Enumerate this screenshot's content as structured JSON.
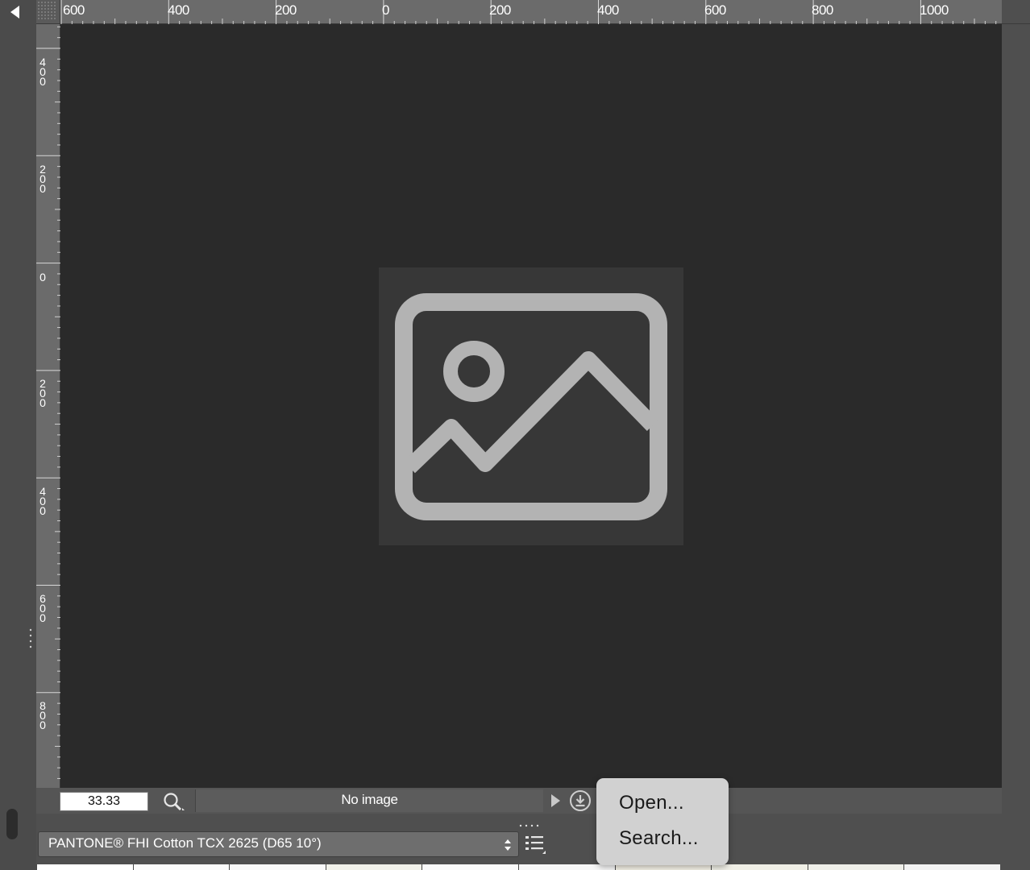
{
  "rulers": {
    "horizontal_labels": [
      "600",
      "400",
      "200",
      "0",
      "200",
      "400",
      "600",
      "800",
      "1000"
    ],
    "vertical_labels": [
      "400",
      "200",
      "0",
      "200",
      "400",
      "600",
      "800"
    ]
  },
  "canvas": {
    "placeholder_icon": "image-placeholder-icon"
  },
  "status_bar": {
    "zoom_value": "33.33",
    "status_text": "No image"
  },
  "color_selector": {
    "selected": "PANTONE® FHI Cotton TCX 2625 (D65 10°)"
  },
  "popup_menu": {
    "items": [
      "Open...",
      "Search..."
    ]
  },
  "swatches": [
    "#ffffff",
    "#fbfbfb",
    "#f9f9f9",
    "#f1f1ea",
    "#fafafa",
    "#f7f7f7",
    "#f4f1e6",
    "#f0efe6",
    "#efefe9",
    "#f3f3f3"
  ],
  "colors": {
    "canvas_background": "#2a2a2a",
    "ruler_background": "#6b6b6b",
    "menu_background": "#d1d1d1"
  }
}
